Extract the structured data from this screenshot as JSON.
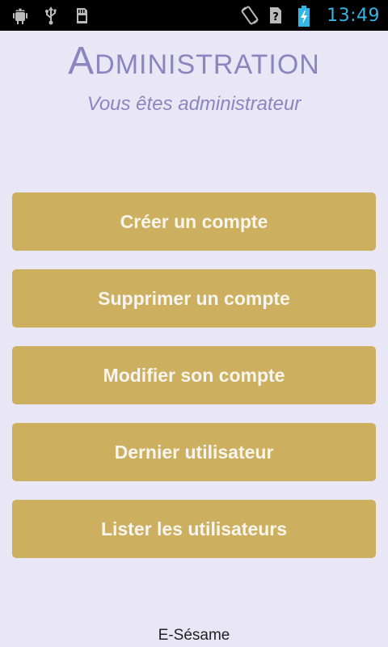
{
  "status_bar": {
    "time": "13:49",
    "time_color": "#33b5e5",
    "left_icons": [
      "android-debug-icon",
      "usb-icon",
      "sd-card-icon"
    ],
    "right_icons": [
      "rotate-icon",
      "signal-no-sim-icon",
      "battery-charging-icon"
    ]
  },
  "header": {
    "title": "Administration",
    "subtitle": "Vous êtes administrateur"
  },
  "buttons": [
    {
      "label": "Créer un compte"
    },
    {
      "label": "Supprimer un compte"
    },
    {
      "label": "Modifier son compte"
    },
    {
      "label": "Dernier utilisateur"
    },
    {
      "label": "Lister les utilisateurs"
    }
  ],
  "footer": {
    "text": "E-Sésame"
  },
  "colors": {
    "background": "#e9e7f5",
    "title": "#8a86c0",
    "button": "#ccb05f",
    "button_text": "#f7f5ee"
  }
}
